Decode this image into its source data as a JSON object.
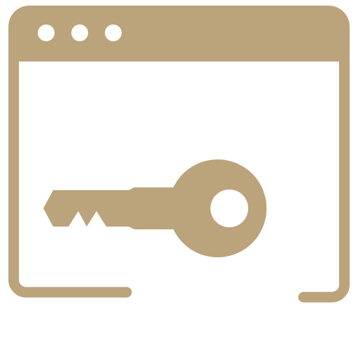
{
  "icon": {
    "name": "browser-key-icon",
    "color": "#BBA37B",
    "background": "#FFFFFF",
    "window_dots": 3
  }
}
